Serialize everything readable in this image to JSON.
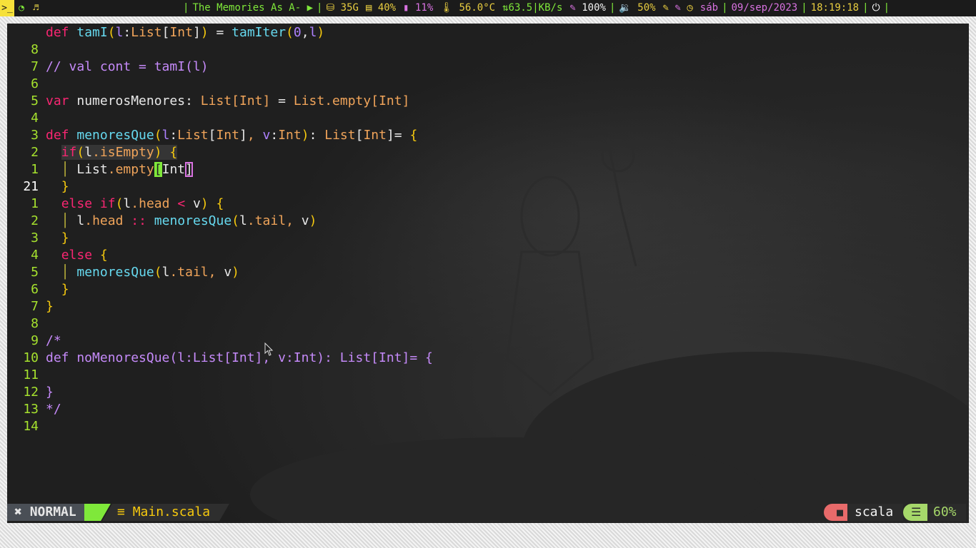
{
  "topbar": {
    "workspaces": [
      {
        "icon": "terminal-icon",
        "glyph": ">_"
      },
      {
        "icon": "browser-icon",
        "glyph": "◔"
      },
      {
        "icon": "music-icon",
        "glyph": "♬"
      }
    ],
    "song": "The Memories As A-",
    "play_glyph": "▶",
    "disk": "35G",
    "mem": "40%",
    "swap": "11%",
    "temp": "56.0°C",
    "net": "63.5|KB/s",
    "cpu": "100%",
    "volume": "50%",
    "day": "sáb",
    "date": "09/sep/2023",
    "time": "18:19:18"
  },
  "editor": {
    "lines": [
      {
        "num": "8"
      },
      {
        "num": "7"
      },
      {
        "num": "6",
        "text": "// val cont = tamI(l)"
      },
      {
        "num": "5"
      },
      {
        "num": "4"
      },
      {
        "num": "3"
      },
      {
        "num": "2"
      },
      {
        "num": "1"
      },
      {
        "num": "21"
      },
      {
        "num": "1"
      },
      {
        "num": "2"
      },
      {
        "num": "3"
      },
      {
        "num": "4"
      },
      {
        "num": "5"
      },
      {
        "num": "6"
      },
      {
        "num": "7"
      },
      {
        "num": "8"
      },
      {
        "num": "9"
      },
      {
        "num": "10",
        "text": "/*"
      },
      {
        "num": "11",
        "text": "def noMenoresQue(l:List[Int], v:Int): List[Int]= {"
      },
      {
        "num": "12"
      },
      {
        "num": "13",
        "text": "}"
      },
      {
        "num": "14",
        "text": "*/"
      }
    ],
    "tokens": {
      "def": "def",
      "var": "var",
      "if": "if",
      "else": "else",
      "tamI": "tamI",
      "tamIter": "tamIter",
      "menoresQue": "menoresQue",
      "numerosMenores": "numerosMenores",
      "List": "List",
      "Int": "Int",
      "empty": "empty",
      "isEmpty": "isEmpty",
      "head": "head",
      "tail": "tail",
      "l": "l",
      "v": "v",
      "zero": "0"
    }
  },
  "statusline": {
    "mode_icon": "✖",
    "mode": "NORMAL",
    "file_icon": "≡",
    "filename": "Main.scala",
    "folder_icon": "■",
    "filetype": "scala",
    "lines_icon": "☰",
    "percent": "60%"
  },
  "colors": {
    "line_number": "#a6e22e",
    "keyword": "#f92672",
    "function": "#66d9ef",
    "type": "#f0a45a",
    "comment": "#c58af9",
    "cursor": "#7fe83a"
  }
}
